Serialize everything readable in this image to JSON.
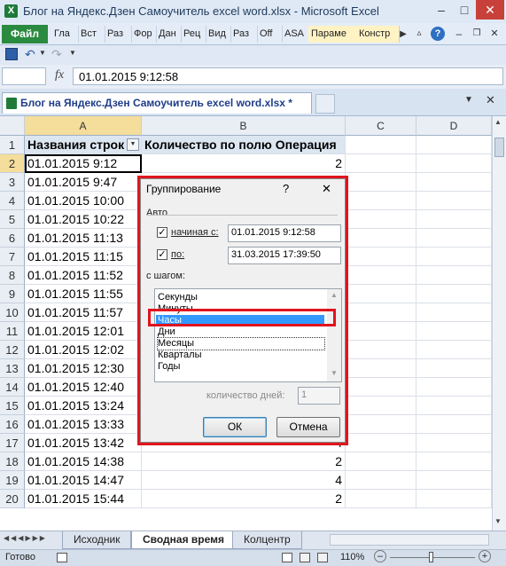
{
  "window": {
    "title": "Блог на Яндекс.Дзен Самоучитель excel word.xlsx  -  Microsoft Excel",
    "minimize_glyph": "–",
    "maximize_glyph": "□",
    "close_glyph": "✕"
  },
  "ribbon": {
    "file_label": "Файл",
    "tabs": [
      "Гла",
      "Вст",
      "Раз",
      "Фор",
      "Дан",
      "Рец",
      "Вид",
      "Раз",
      "Off",
      "ASA",
      "Параме",
      "Констр"
    ],
    "help_glyph": "?"
  },
  "formula_bar": {
    "fx_label": "fx",
    "value": "01.01.2015  9:12:58"
  },
  "workbook": {
    "tab_title": "Блог на Яндекс.Дзен Самоучитель excel word.xlsx *"
  },
  "grid": {
    "columns": [
      "A",
      "B",
      "C",
      "D"
    ],
    "rows": [
      {
        "n": "1",
        "a": "Названия строк",
        "b": "Количество по полю Операция"
      },
      {
        "n": "2",
        "a": "01.01.2015 9:12",
        "b": "2"
      },
      {
        "n": "3",
        "a": "01.01.2015 9:47",
        "b": ""
      },
      {
        "n": "4",
        "a": "01.01.2015 10:00",
        "b": ""
      },
      {
        "n": "5",
        "a": "01.01.2015 10:22",
        "b": ""
      },
      {
        "n": "6",
        "a": "01.01.2015 11:13",
        "b": ""
      },
      {
        "n": "7",
        "a": "01.01.2015 11:15",
        "b": ""
      },
      {
        "n": "8",
        "a": "01.01.2015 11:52",
        "b": ""
      },
      {
        "n": "9",
        "a": "01.01.2015 11:55",
        "b": ""
      },
      {
        "n": "10",
        "a": "01.01.2015 11:57",
        "b": ""
      },
      {
        "n": "11",
        "a": "01.01.2015 12:01",
        "b": ""
      },
      {
        "n": "12",
        "a": "01.01.2015 12:02",
        "b": ""
      },
      {
        "n": "13",
        "a": "01.01.2015 12:30",
        "b": ""
      },
      {
        "n": "14",
        "a": "01.01.2015 12:40",
        "b": ""
      },
      {
        "n": "15",
        "a": "01.01.2015 13:24",
        "b": ""
      },
      {
        "n": "16",
        "a": "01.01.2015 13:33",
        "b": ""
      },
      {
        "n": "17",
        "a": "01.01.2015 13:42",
        "b": "4"
      },
      {
        "n": "18",
        "a": "01.01.2015 14:38",
        "b": "2"
      },
      {
        "n": "19",
        "a": "01.01.2015 14:47",
        "b": "4"
      },
      {
        "n": "20",
        "a": "01.01.2015 15:44",
        "b": "2"
      }
    ]
  },
  "sheets": {
    "tabs": [
      "Исходник",
      "Сводная время",
      "Колцентр"
    ],
    "active_index": 1
  },
  "status": {
    "ready": "Готово",
    "zoom": "110%"
  },
  "dialog": {
    "title": "Группирование",
    "help": "?",
    "close": "✕",
    "auto_label": "Авто",
    "start_label": "начиная с:",
    "start_value": "01.01.2015 9:12:58",
    "start_checked": true,
    "end_label": "по:",
    "end_value": "31.03.2015 17:39:50",
    "end_checked": true,
    "step_label": "с шагом:",
    "step_items": [
      "Секунды",
      "Минуты",
      "Часы",
      "Дни",
      "Месяцы",
      "Кварталы",
      "Годы"
    ],
    "selected_item": "Часы",
    "days_label": "количество дней:",
    "days_value": "1",
    "ok_label": "ОК",
    "cancel_label": "Отмена"
  },
  "colors": {
    "accent_red": "#e0141e",
    "selection_blue": "#3399ff",
    "file_tab_green": "#2a8a3f"
  }
}
